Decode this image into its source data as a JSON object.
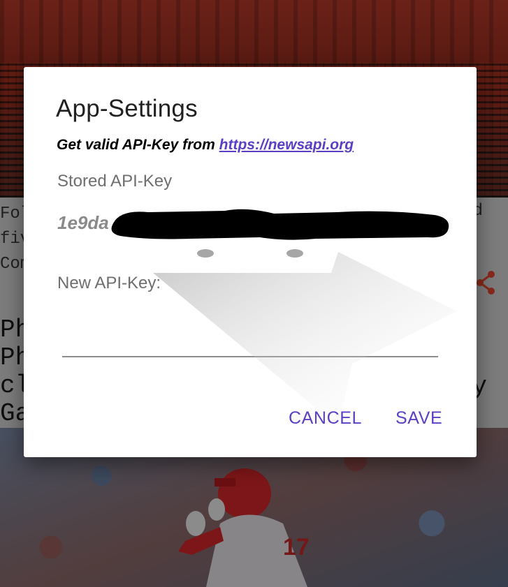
{
  "background": {
    "snippet_lines": [
      "Fol",
      "fiv",
      "Com"
    ],
    "snippet_right": "d",
    "headline_lines": [
      "Ph",
      "Ph",
      "cl",
      "Ga"
    ],
    "headline_right": "y",
    "share_icon": "share-icon"
  },
  "dialog": {
    "title": "App-Settings",
    "hint_prefix": "Get valid API-Key from ",
    "hint_link": "https://newsapi.org",
    "stored_label": "Stored API-Key",
    "stored_value_visible": "1e9da",
    "new_label": "New API-Key:",
    "new_value": "",
    "cancel_label": "CANCEL",
    "save_label": "SAVE"
  },
  "colors": {
    "accent": "#5b3fc4",
    "scrim": "rgba(0,0,0,0.42)",
    "redaction": "#000000"
  }
}
